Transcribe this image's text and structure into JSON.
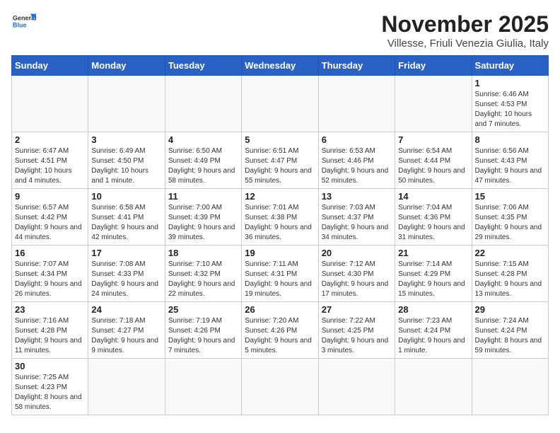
{
  "header": {
    "logo_general": "General",
    "logo_blue": "Blue",
    "month_title": "November 2025",
    "subtitle": "Villesse, Friuli Venezia Giulia, Italy"
  },
  "weekdays": [
    "Sunday",
    "Monday",
    "Tuesday",
    "Wednesday",
    "Thursday",
    "Friday",
    "Saturday"
  ],
  "weeks": [
    [
      {
        "day": "",
        "info": ""
      },
      {
        "day": "",
        "info": ""
      },
      {
        "day": "",
        "info": ""
      },
      {
        "day": "",
        "info": ""
      },
      {
        "day": "",
        "info": ""
      },
      {
        "day": "",
        "info": ""
      },
      {
        "day": "1",
        "info": "Sunrise: 6:46 AM\nSunset: 4:53 PM\nDaylight: 10 hours and 7 minutes."
      }
    ],
    [
      {
        "day": "2",
        "info": "Sunrise: 6:47 AM\nSunset: 4:51 PM\nDaylight: 10 hours and 4 minutes."
      },
      {
        "day": "3",
        "info": "Sunrise: 6:49 AM\nSunset: 4:50 PM\nDaylight: 10 hours and 1 minute."
      },
      {
        "day": "4",
        "info": "Sunrise: 6:50 AM\nSunset: 4:49 PM\nDaylight: 9 hours and 58 minutes."
      },
      {
        "day": "5",
        "info": "Sunrise: 6:51 AM\nSunset: 4:47 PM\nDaylight: 9 hours and 55 minutes."
      },
      {
        "day": "6",
        "info": "Sunrise: 6:53 AM\nSunset: 4:46 PM\nDaylight: 9 hours and 52 minutes."
      },
      {
        "day": "7",
        "info": "Sunrise: 6:54 AM\nSunset: 4:44 PM\nDaylight: 9 hours and 50 minutes."
      },
      {
        "day": "8",
        "info": "Sunrise: 6:56 AM\nSunset: 4:43 PM\nDaylight: 9 hours and 47 minutes."
      }
    ],
    [
      {
        "day": "9",
        "info": "Sunrise: 6:57 AM\nSunset: 4:42 PM\nDaylight: 9 hours and 44 minutes."
      },
      {
        "day": "10",
        "info": "Sunrise: 6:58 AM\nSunset: 4:41 PM\nDaylight: 9 hours and 42 minutes."
      },
      {
        "day": "11",
        "info": "Sunrise: 7:00 AM\nSunset: 4:39 PM\nDaylight: 9 hours and 39 minutes."
      },
      {
        "day": "12",
        "info": "Sunrise: 7:01 AM\nSunset: 4:38 PM\nDaylight: 9 hours and 36 minutes."
      },
      {
        "day": "13",
        "info": "Sunrise: 7:03 AM\nSunset: 4:37 PM\nDaylight: 9 hours and 34 minutes."
      },
      {
        "day": "14",
        "info": "Sunrise: 7:04 AM\nSunset: 4:36 PM\nDaylight: 9 hours and 31 minutes."
      },
      {
        "day": "15",
        "info": "Sunrise: 7:06 AM\nSunset: 4:35 PM\nDaylight: 9 hours and 29 minutes."
      }
    ],
    [
      {
        "day": "16",
        "info": "Sunrise: 7:07 AM\nSunset: 4:34 PM\nDaylight: 9 hours and 26 minutes."
      },
      {
        "day": "17",
        "info": "Sunrise: 7:08 AM\nSunset: 4:33 PM\nDaylight: 9 hours and 24 minutes."
      },
      {
        "day": "18",
        "info": "Sunrise: 7:10 AM\nSunset: 4:32 PM\nDaylight: 9 hours and 22 minutes."
      },
      {
        "day": "19",
        "info": "Sunrise: 7:11 AM\nSunset: 4:31 PM\nDaylight: 9 hours and 19 minutes."
      },
      {
        "day": "20",
        "info": "Sunrise: 7:12 AM\nSunset: 4:30 PM\nDaylight: 9 hours and 17 minutes."
      },
      {
        "day": "21",
        "info": "Sunrise: 7:14 AM\nSunset: 4:29 PM\nDaylight: 9 hours and 15 minutes."
      },
      {
        "day": "22",
        "info": "Sunrise: 7:15 AM\nSunset: 4:28 PM\nDaylight: 9 hours and 13 minutes."
      }
    ],
    [
      {
        "day": "23",
        "info": "Sunrise: 7:16 AM\nSunset: 4:28 PM\nDaylight: 9 hours and 11 minutes."
      },
      {
        "day": "24",
        "info": "Sunrise: 7:18 AM\nSunset: 4:27 PM\nDaylight: 9 hours and 9 minutes."
      },
      {
        "day": "25",
        "info": "Sunrise: 7:19 AM\nSunset: 4:26 PM\nDaylight: 9 hours and 7 minutes."
      },
      {
        "day": "26",
        "info": "Sunrise: 7:20 AM\nSunset: 4:26 PM\nDaylight: 9 hours and 5 minutes."
      },
      {
        "day": "27",
        "info": "Sunrise: 7:22 AM\nSunset: 4:25 PM\nDaylight: 9 hours and 3 minutes."
      },
      {
        "day": "28",
        "info": "Sunrise: 7:23 AM\nSunset: 4:24 PM\nDaylight: 9 hours and 1 minute."
      },
      {
        "day": "29",
        "info": "Sunrise: 7:24 AM\nSunset: 4:24 PM\nDaylight: 8 hours and 59 minutes."
      }
    ],
    [
      {
        "day": "30",
        "info": "Sunrise: 7:25 AM\nSunset: 4:23 PM\nDaylight: 8 hours and 58 minutes."
      },
      {
        "day": "",
        "info": ""
      },
      {
        "day": "",
        "info": ""
      },
      {
        "day": "",
        "info": ""
      },
      {
        "day": "",
        "info": ""
      },
      {
        "day": "",
        "info": ""
      },
      {
        "day": "",
        "info": ""
      }
    ]
  ]
}
